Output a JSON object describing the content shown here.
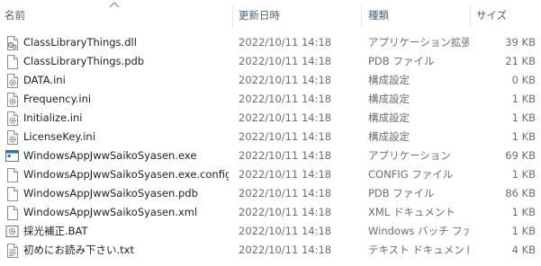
{
  "header": {
    "name": "名前",
    "date": "更新日時",
    "type": "種類",
    "size": "サイズ"
  },
  "files": [
    {
      "name": "ClassLibraryThings.dll",
      "date": "2022/10/11 14:18",
      "type": "アプリケーション拡張",
      "size": "39 KB",
      "icon": "dll-file-icon"
    },
    {
      "name": "ClassLibraryThings.pdb",
      "date": "2022/10/11 14:18",
      "type": "PDB ファイル",
      "size": "21 KB",
      "icon": "blank-file-icon"
    },
    {
      "name": "DATA.ini",
      "date": "2022/10/11 14:18",
      "type": "構成設定",
      "size": "0 KB",
      "icon": "settings-file-icon"
    },
    {
      "name": "Frequency.ini",
      "date": "2022/10/11 14:18",
      "type": "構成設定",
      "size": "1 KB",
      "icon": "settings-file-icon"
    },
    {
      "name": "Initialize.ini",
      "date": "2022/10/11 14:18",
      "type": "構成設定",
      "size": "1 KB",
      "icon": "settings-file-icon"
    },
    {
      "name": "LicenseKey.ini",
      "date": "2022/10/11 14:18",
      "type": "構成設定",
      "size": "1 KB",
      "icon": "settings-file-icon"
    },
    {
      "name": "WindowsAppJwwSaikoSyasen.exe",
      "date": "2022/10/11 14:18",
      "type": "アプリケーション",
      "size": "69 KB",
      "icon": "application-icon"
    },
    {
      "name": "WindowsAppJwwSaikoSyasen.exe.config",
      "date": "2022/10/11 14:18",
      "type": "CONFIG ファイル",
      "size": "1 KB",
      "icon": "blank-file-icon"
    },
    {
      "name": "WindowsAppJwwSaikoSyasen.pdb",
      "date": "2022/10/11 14:18",
      "type": "PDB ファイル",
      "size": "86 KB",
      "icon": "blank-file-icon"
    },
    {
      "name": "WindowsAppJwwSaikoSyasen.xml",
      "date": "2022/10/11 14:18",
      "type": "XML ドキュメント",
      "size": "1 KB",
      "icon": "blank-file-icon"
    },
    {
      "name": "採光補正.BAT",
      "date": "2022/10/11 14:18",
      "type": "Windows バッチ ファ...",
      "size": "1 KB",
      "icon": "batch-file-icon"
    },
    {
      "name": "初めにお読み下さい.txt",
      "date": "2022/10/11 14:18",
      "type": "テキスト ドキュメント",
      "size": "4 KB",
      "icon": "text-file-icon"
    }
  ]
}
